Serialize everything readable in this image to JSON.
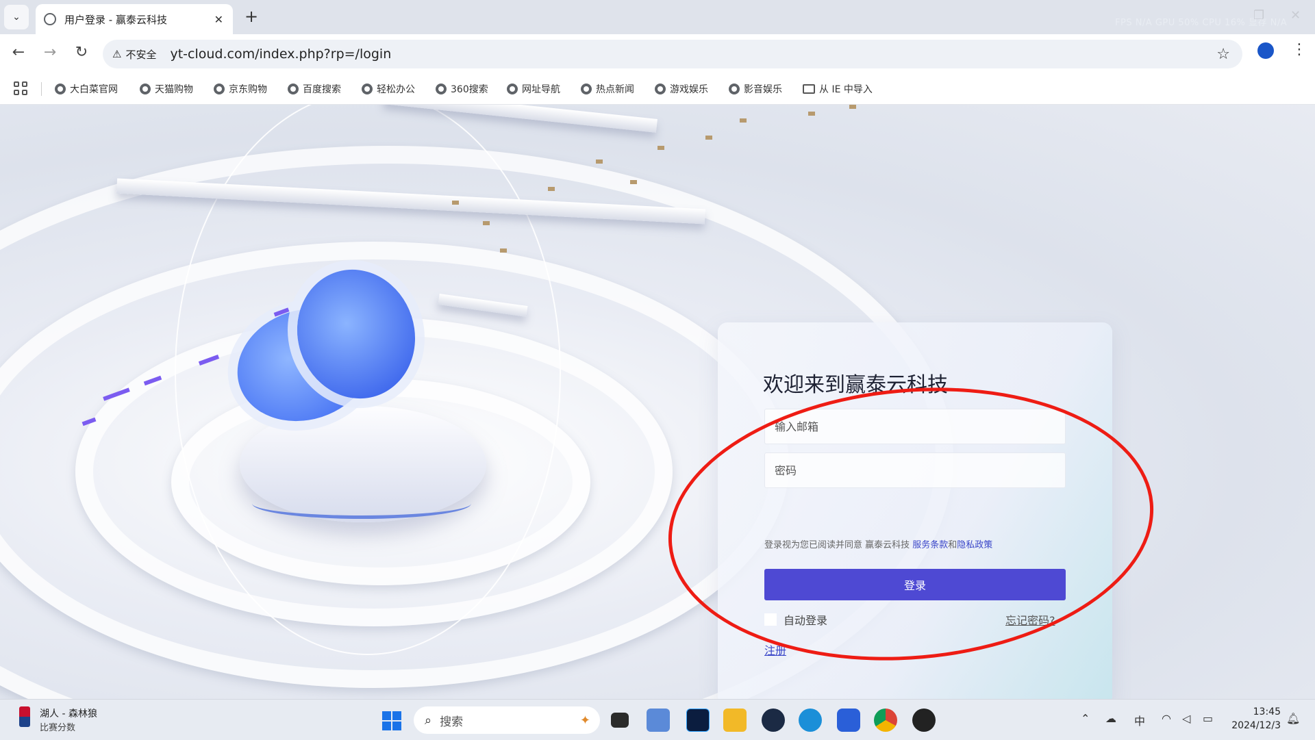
{
  "browser": {
    "tab_title": "用户登录 - 赢泰云科技",
    "tab_close": "✕",
    "new_tab": "+",
    "perf_overlay": "FPS N/A GPU 50% CPU 16% 显存 N/A",
    "security_label": "不安全",
    "url": "yt-cloud.com/index.php?rp=/login"
  },
  "bookmarks": [
    {
      "label": "大白菜官网"
    },
    {
      "label": "天猫购物"
    },
    {
      "label": "京东购物"
    },
    {
      "label": "百度搜索"
    },
    {
      "label": "轻松办公"
    },
    {
      "label": "360搜索"
    },
    {
      "label": "网址导航"
    },
    {
      "label": "热点新闻"
    },
    {
      "label": "游戏娱乐"
    },
    {
      "label": "影音娱乐"
    },
    {
      "label": "从 IE 中导入"
    }
  ],
  "login": {
    "title": "欢迎来到赢泰云科技",
    "email_placeholder": "输入邮箱",
    "password_placeholder": "密码",
    "agree_prefix": "登录视为您已阅读并同意 赢泰云科技 ",
    "terms_link": "服务条款",
    "and": "和",
    "privacy_link": "隐私政策",
    "login_button": "登录",
    "auto_login": "自动登录",
    "forgot_password": "忘记密码?",
    "register": "注册"
  },
  "taskbar": {
    "news_title": "湖人 - 森林狼",
    "news_sub": "比赛分数",
    "search_placeholder": "搜索",
    "ime": "中",
    "time": "13:45",
    "date": "2024/12/3"
  },
  "colors": {
    "accent": "#4e49d3",
    "annotation_circle": "#ee1c14",
    "link": "#3a46c8"
  }
}
